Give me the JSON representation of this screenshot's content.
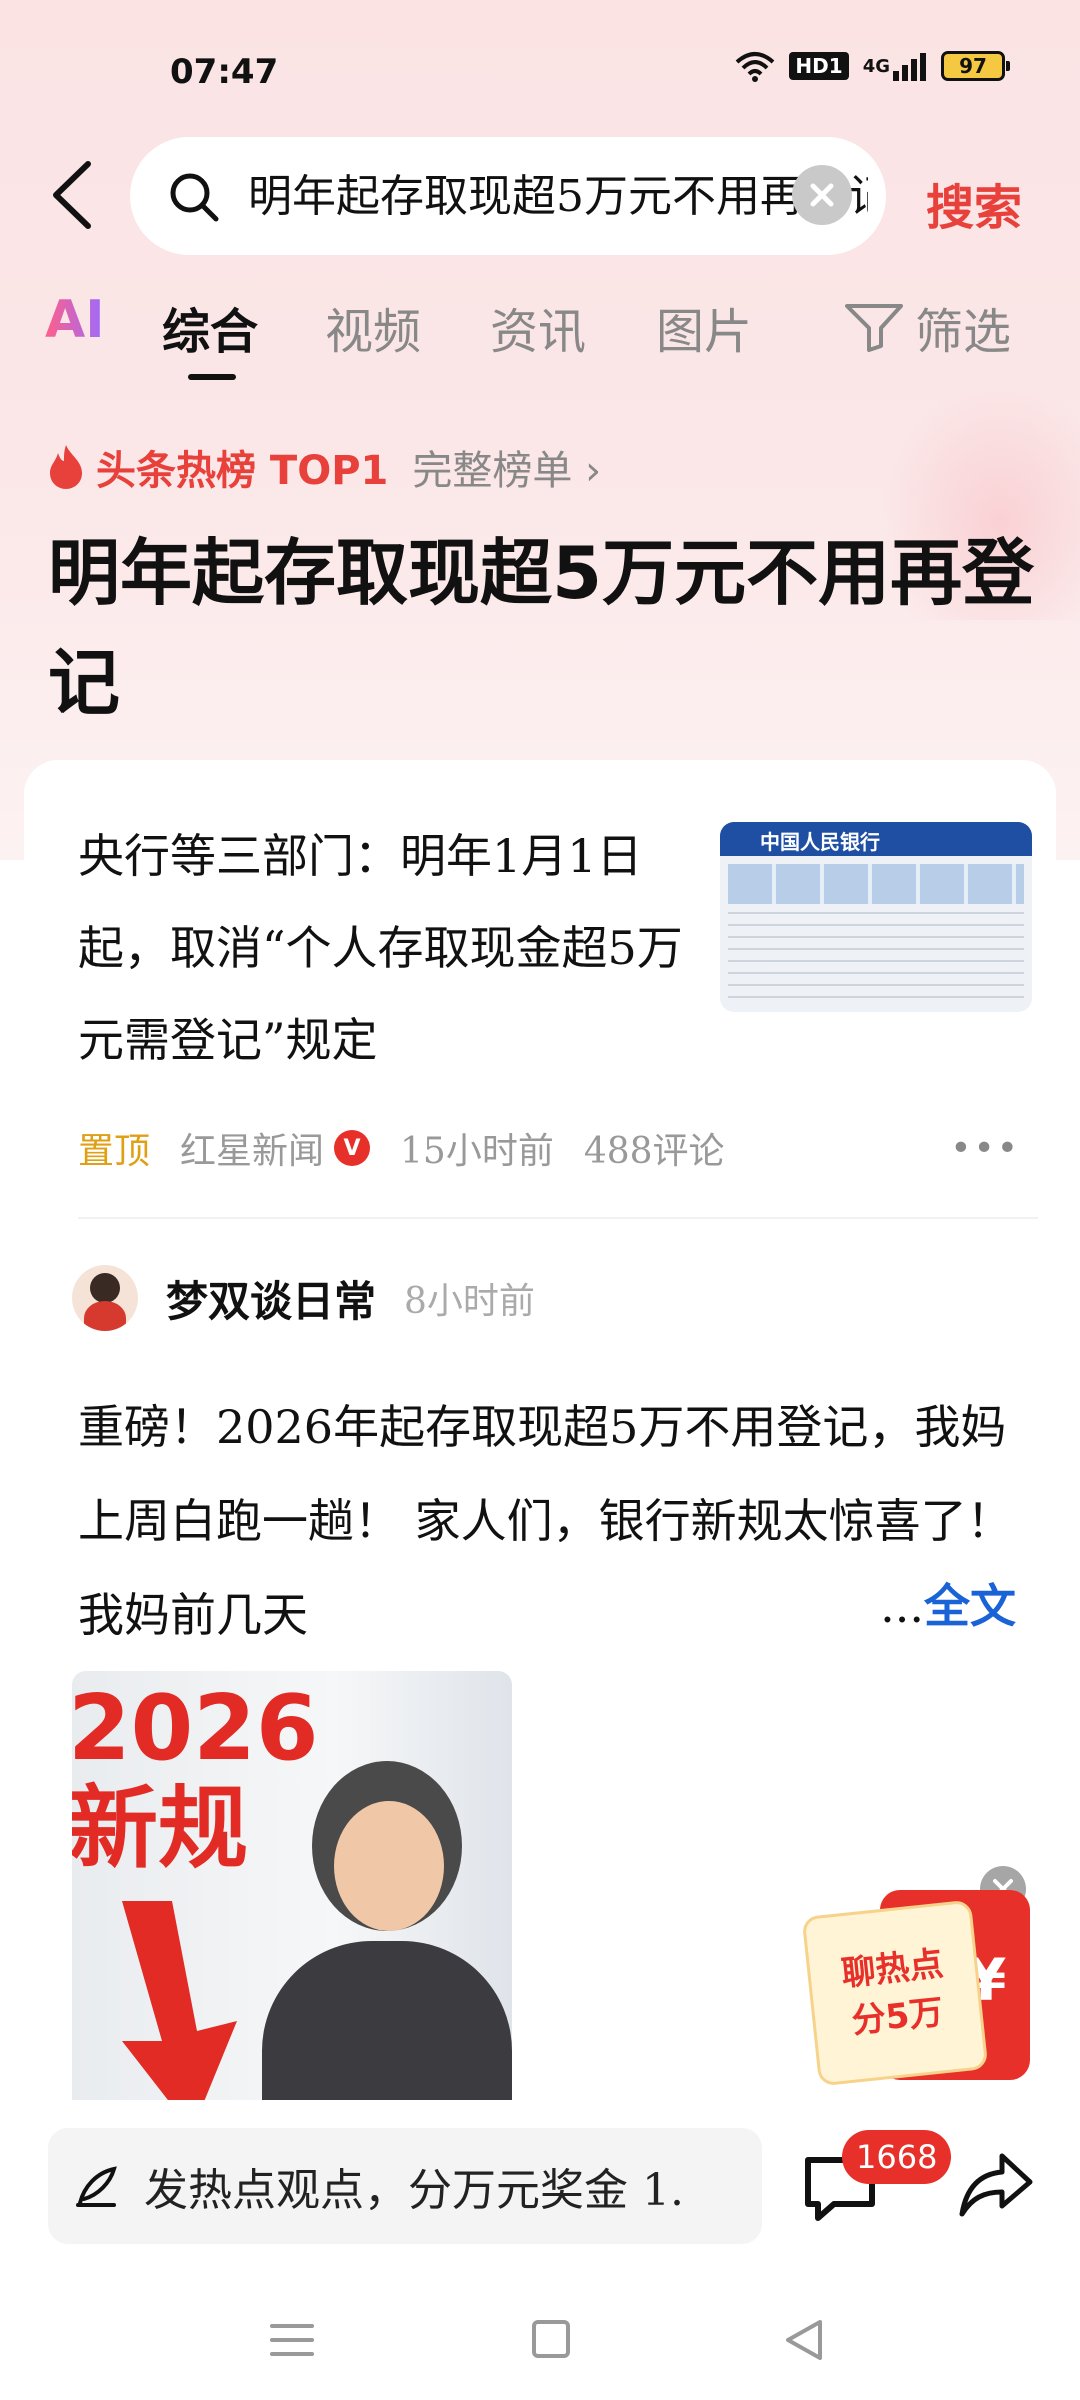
{
  "status_bar": {
    "time": "07:47",
    "network_badge": "HD1",
    "signal_label": "4G",
    "battery": "97",
    "icons": [
      "wifi-icon",
      "signal-icon",
      "battery-icon"
    ]
  },
  "search": {
    "query": "明年起存取现超5万元不用再登记",
    "action_label": "搜索",
    "icons": [
      "back-arrow-icon",
      "search-icon",
      "clear-icon"
    ]
  },
  "tabs": {
    "ai_label": "AI",
    "items": [
      "综合",
      "视频",
      "资讯",
      "图片"
    ],
    "active": "综合",
    "filter_label": "筛选",
    "filter_icon": "filter-icon"
  },
  "hot": {
    "label": "头条热榜 TOP1",
    "full_list": "完整榜单 ›",
    "title": "明年起存取现超5万元不用再登记",
    "icon": "fire-icon"
  },
  "news": {
    "title": "央行等三部门：明年1月1日起，取消“个人存取现金超5万元需登记”规定",
    "pin": "置顶",
    "source": "红星新闻",
    "verified_mark": "V",
    "time": "15小时前",
    "comments": "488评论",
    "more": "•••",
    "thumb_heading": "中国人民银行"
  },
  "post": {
    "author": "梦双谈日常",
    "time": "8小时前",
    "body": "重磅！2026年起存取现超5万不用登记，我妈上周白跑一趟！ 家人们，银行新规太惊喜了！我妈前几天",
    "ellipsis": "...",
    "fulltext": "全文",
    "image_caption_1": "2026",
    "image_caption_2": "新规"
  },
  "float_packet": {
    "line1": "聊热点",
    "line2": "分5万",
    "yen": "¥"
  },
  "bottom": {
    "placeholder": "发热点观点，分万元奖金 1.",
    "comment_count": "1668",
    "icons": [
      "pen-icon",
      "comment-icon",
      "share-icon"
    ]
  },
  "colors": {
    "accent_red": "#e8403a",
    "link_blue": "#1a63d6",
    "pin_gold": "#e0a016",
    "header_bg": "#fbe3e4"
  }
}
